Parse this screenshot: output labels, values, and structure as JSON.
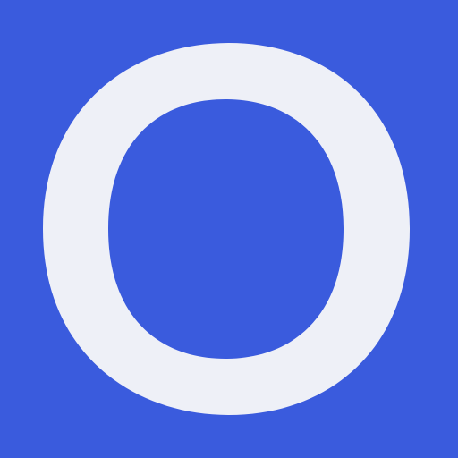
{
  "icon": {
    "logo_letter": "O",
    "logo_name": "letter-o-logo",
    "colors": {
      "background": "#3A5BDD",
      "glyph": "#EEF0F7"
    }
  }
}
